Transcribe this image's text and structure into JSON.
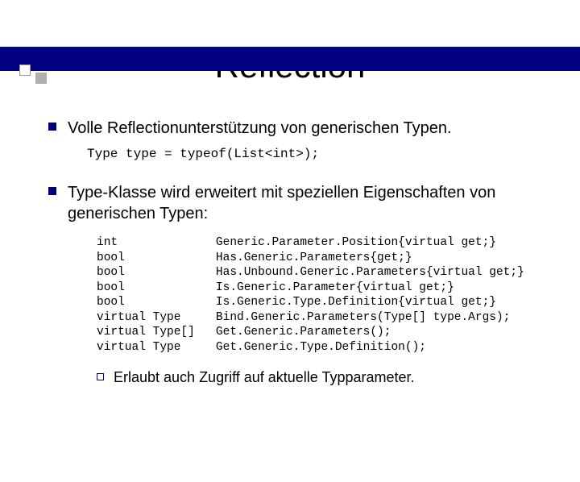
{
  "title": "Reflection",
  "bullets": [
    {
      "text": "Volle Reflectionunterstützung von generischen Typen.",
      "code": "Type type = typeof(List<int>);"
    },
    {
      "text": "Type-Klasse wird erweitert mit speziellen Eigenschaften von generischen Typen:",
      "codeblock": "int              Generic.Parameter.Position{virtual get;}\nbool             Has.Generic.Parameters{get;}\nbool             Has.Unbound.Generic.Parameters{virtual get;}\nbool             Is.Generic.Parameter{virtual get;}\nbool             Is.Generic.Type.Definition{virtual get;}\nvirtual Type     Bind.Generic.Parameters(Type[] type.Args);\nvirtual Type[]   Get.Generic.Parameters();\nvirtual Type     Get.Generic.Type.Definition();",
      "sub": "Erlaubt auch Zugriff auf aktuelle Typparameter."
    }
  ]
}
